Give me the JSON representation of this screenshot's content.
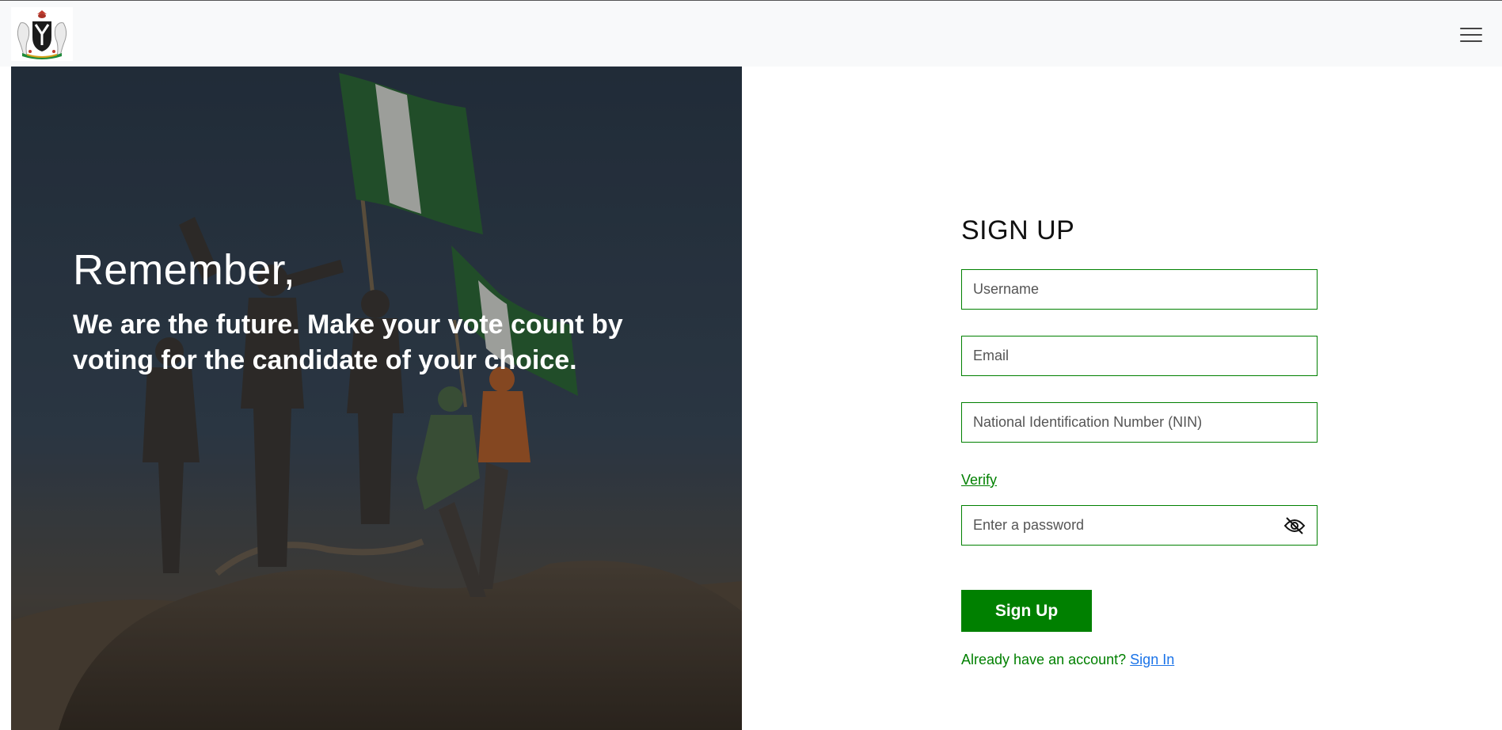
{
  "header": {
    "logo_icon": "coat-of-arms-icon",
    "menu_icon": "hamburger-menu-icon"
  },
  "hero": {
    "title": "Remember,",
    "subtitle": "We are the future. Make your vote count by voting for the candidate of your choice."
  },
  "form": {
    "title": "SIGN UP",
    "username_placeholder": "Username",
    "email_placeholder": "Email",
    "nin_placeholder": "National Identification Number (NIN)",
    "verify_label": "Verify",
    "password_placeholder": "Enter a password",
    "password_toggle_icon": "eye-slash-icon",
    "submit_label": "Sign Up",
    "signin_prompt": "Already have an account?",
    "signin_link": "Sign In"
  },
  "colors": {
    "accent_green": "#008000",
    "link_blue": "#1a73e8",
    "topbar_bg": "#f8f9fa"
  }
}
